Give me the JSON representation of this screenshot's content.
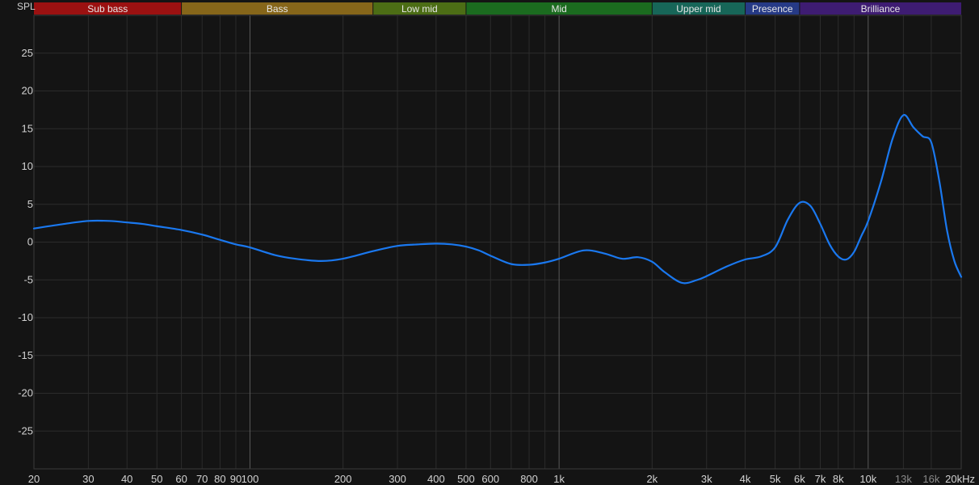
{
  "chart_data": {
    "type": "line",
    "title": "",
    "xlabel": "",
    "ylabel": "SPL",
    "x_unit": "kHz",
    "x_scale": "log",
    "xlim": [
      20,
      20000
    ],
    "ylim": [
      -30,
      30
    ],
    "grid": true,
    "x_ticks": [
      {
        "value": 20,
        "label": "20",
        "major": false
      },
      {
        "value": 30,
        "label": "30",
        "major": false
      },
      {
        "value": 40,
        "label": "40",
        "major": false
      },
      {
        "value": 50,
        "label": "50",
        "major": false
      },
      {
        "value": 60,
        "label": "60",
        "major": false
      },
      {
        "value": 70,
        "label": "70",
        "major": false
      },
      {
        "value": 80,
        "label": "80",
        "major": false
      },
      {
        "value": 90,
        "label": "90",
        "major": false
      },
      {
        "value": 100,
        "label": "100",
        "major": true
      },
      {
        "value": 200,
        "label": "200",
        "major": false
      },
      {
        "value": 300,
        "label": "300",
        "major": false
      },
      {
        "value": 400,
        "label": "400",
        "major": false
      },
      {
        "value": 500,
        "label": "500",
        "major": false
      },
      {
        "value": 600,
        "label": "600",
        "major": false
      },
      {
        "value": 800,
        "label": "800",
        "major": false
      },
      {
        "value": 1000,
        "label": "1k",
        "major": true
      },
      {
        "value": 2000,
        "label": "2k",
        "major": false
      },
      {
        "value": 3000,
        "label": "3k",
        "major": false
      },
      {
        "value": 4000,
        "label": "4k",
        "major": false
      },
      {
        "value": 5000,
        "label": "5k",
        "major": false
      },
      {
        "value": 6000,
        "label": "6k",
        "major": false
      },
      {
        "value": 7000,
        "label": "7k",
        "major": false
      },
      {
        "value": 8000,
        "label": "8k",
        "major": false
      },
      {
        "value": 10000,
        "label": "10k",
        "major": true
      },
      {
        "value": 13000,
        "label": "13k",
        "major": false,
        "dim": true
      },
      {
        "value": 16000,
        "label": "16k",
        "major": false,
        "dim": true
      },
      {
        "value": 20000,
        "label": "20kHz",
        "major": false
      }
    ],
    "x_minor_grid": [
      700,
      900,
      9000
    ],
    "y_ticks": [
      25,
      20,
      15,
      10,
      5,
      0,
      -5,
      -10,
      -15,
      -20,
      -25
    ],
    "bands": [
      {
        "name": "Sub bass",
        "from": 20,
        "to": 60,
        "color": "#9b1111"
      },
      {
        "name": "Bass",
        "from": 60,
        "to": 250,
        "color": "#86661a"
      },
      {
        "name": "Low mid",
        "from": 250,
        "to": 500,
        "color": "#4c6d15"
      },
      {
        "name": "Mid",
        "from": 500,
        "to": 2000,
        "color": "#1b6b1f"
      },
      {
        "name": "Upper mid",
        "from": 2000,
        "to": 4000,
        "color": "#176658"
      },
      {
        "name": "Presence",
        "from": 4000,
        "to": 6000,
        "color": "#263a86"
      },
      {
        "name": "Brilliance",
        "from": 6000,
        "to": 20000,
        "color": "#3e1c72"
      }
    ],
    "colors": {
      "line": "#1a78ef",
      "background": "#141414",
      "grid": "#2c2c2c",
      "grid_major": "#595959",
      "text": "#d2d2d2",
      "text_dim": "#8a8a8a"
    },
    "series": [
      {
        "x": [
          20,
          25,
          30,
          35,
          40,
          45,
          50,
          60,
          70,
          80,
          90,
          100,
          120,
          140,
          170,
          200,
          250,
          300,
          350,
          400,
          450,
          500,
          550,
          600,
          700,
          800,
          900,
          1000,
          1200,
          1400,
          1600,
          1800,
          2000,
          2200,
          2500,
          2800,
          3000,
          3500,
          4000,
          4500,
          5000,
          5500,
          6000,
          6500,
          7000,
          7500,
          8000,
          8500,
          9000,
          9500,
          10000,
          11000,
          12000,
          13000,
          14000,
          15000,
          16000,
          17000,
          18000,
          19000,
          20000
        ],
        "y": [
          1.8,
          2.4,
          2.8,
          2.8,
          2.6,
          2.4,
          2.1,
          1.6,
          1.0,
          0.3,
          -0.3,
          -0.7,
          -1.7,
          -2.2,
          -2.5,
          -2.2,
          -1.2,
          -0.5,
          -0.3,
          -0.2,
          -0.3,
          -0.6,
          -1.1,
          -1.8,
          -2.9,
          -3.0,
          -2.7,
          -2.2,
          -1.1,
          -1.5,
          -2.2,
          -2.0,
          -2.6,
          -4.0,
          -5.4,
          -5.0,
          -4.5,
          -3.2,
          -2.3,
          -1.9,
          -0.7,
          3.0,
          5.2,
          4.8,
          2.4,
          -0.3,
          -1.9,
          -2.3,
          -1.3,
          0.8,
          2.8,
          8.0,
          13.7,
          16.8,
          15.2,
          14.0,
          13.2,
          8.0,
          1.5,
          -2.5,
          -4.6
        ]
      }
    ]
  }
}
